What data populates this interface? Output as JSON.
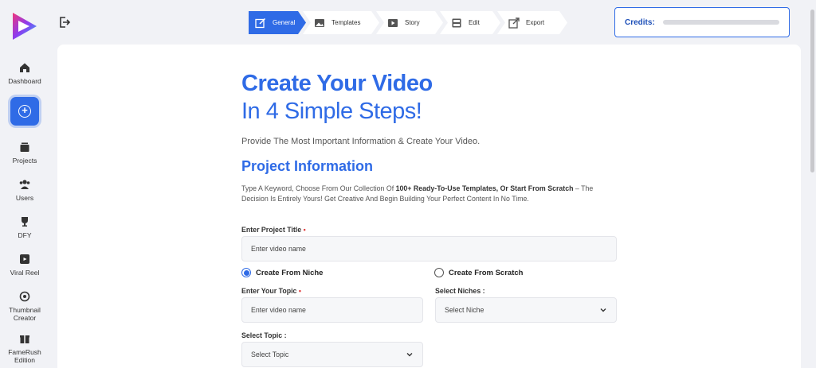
{
  "sidebar": {
    "items": [
      {
        "label": "Dashboard",
        "icon": "home-icon"
      },
      {
        "label": "Projects",
        "icon": "projects-icon"
      },
      {
        "label": "Users",
        "icon": "users-icon"
      },
      {
        "label": "DFY",
        "icon": "trophy-icon"
      },
      {
        "label": "Viral Reel",
        "icon": "reel-icon"
      },
      {
        "label": "Thumbnail",
        "label2": "Creator",
        "icon": "thumbnail-icon"
      },
      {
        "label": "FameRush",
        "label2": "Edition",
        "icon": "gift-icon"
      }
    ],
    "add_icon": "plus-icon"
  },
  "stepper": {
    "steps": [
      {
        "label": "General",
        "active": true
      },
      {
        "label": "Templates",
        "active": false
      },
      {
        "label": "Story",
        "active": false
      },
      {
        "label": "Edit",
        "active": false
      },
      {
        "label": "Export",
        "active": false
      }
    ]
  },
  "credits": {
    "label": "Credits:",
    "fill_fraction": 0
  },
  "main": {
    "title_line1": "Create Your Video",
    "title_line2": "In 4 Simple Steps!",
    "subtitle": "Provide The Most Important Information & Create Your Video.",
    "section_title": "Project Information",
    "desc_part1": "Type A Keyword, Choose From Our Collection Of ",
    "desc_bold": "100+ Ready-To-Use Templates, Or Start From Scratch",
    "desc_part2": " – The Decision Is Entirely Yours! Get Creative And Begin Building Your Perfect Content In No Time.",
    "project_title_label": "Enter Project Title",
    "required_mark": "•",
    "project_title_placeholder": "Enter video name",
    "radio_niche": "Create From Niche",
    "radio_scratch": "Create From Scratch",
    "topic_label": "Enter Your Topic",
    "topic_placeholder": "Enter video name",
    "niches_label": "Select Niches :",
    "niches_value": "Select Niche",
    "select_topic_label": "Select Topic :",
    "select_topic_value": "Select Topic"
  },
  "colors": {
    "accent": "#2f6be6",
    "background": "#f1f2f6"
  }
}
